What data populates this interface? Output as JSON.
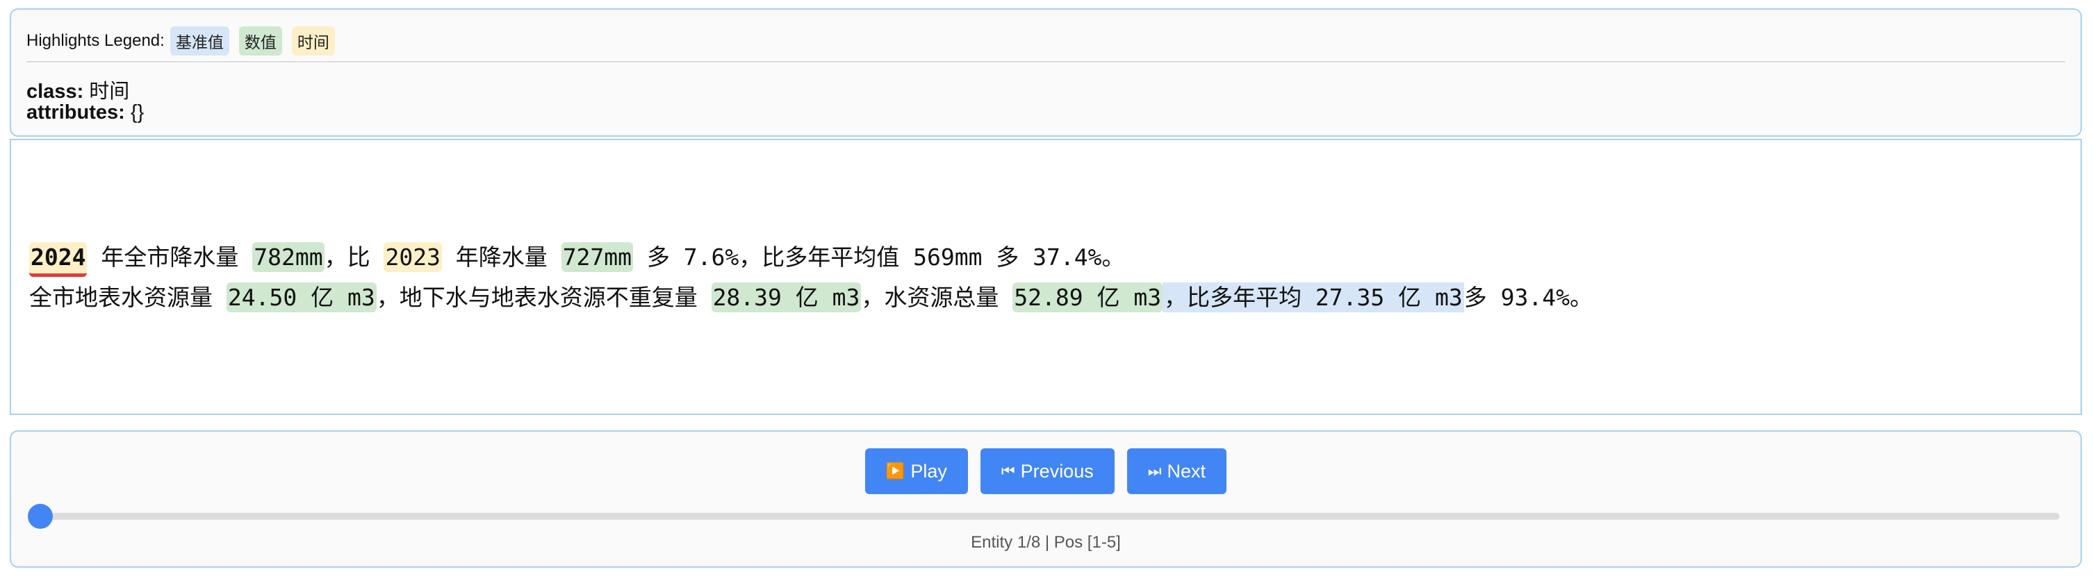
{
  "legend": {
    "title": "Highlights Legend:",
    "chips": [
      "基准值",
      "数值",
      "时间"
    ],
    "colors": {
      "基准值": "#d6e6f8",
      "数值": "#cfe8cf",
      "时间": "#fdf0c7"
    }
  },
  "meta": {
    "class_label": "class:",
    "class_value": "时间",
    "attributes_label": "attributes:",
    "attributes_value": "{}"
  },
  "text": {
    "line1": {
      "s1": "2024",
      "s2": " 年全市降水量 ",
      "s3": "782mm",
      "s4": "，比 ",
      "s5": "2023",
      "s6": " 年降水量 ",
      "s7": "727mm",
      "s8": " 多 7.6%，比多年平均值 569mm 多 37.4%。"
    },
    "line2": {
      "s1": "全市地表水资源量 ",
      "s2": "24.50 亿 m3",
      "s3": "，地下水与地表水资源不重复量 ",
      "s4": "28.39 亿 m3",
      "s5": "，水资源总量 ",
      "s6": "52.89 亿 m3",
      "s7": "，比多年平均 27.35 亿 m3",
      "s8": "多 93.4%。"
    }
  },
  "controls": {
    "play_icon": "▶️",
    "play_label": "Play",
    "prev_icon": "⏮",
    "prev_label": "Previous",
    "next_icon": "⏭",
    "next_label": "Next",
    "progress_fraction": 0.0,
    "status": "Entity 1/8 | Pos [1-5]",
    "accent": "#4285f4"
  }
}
